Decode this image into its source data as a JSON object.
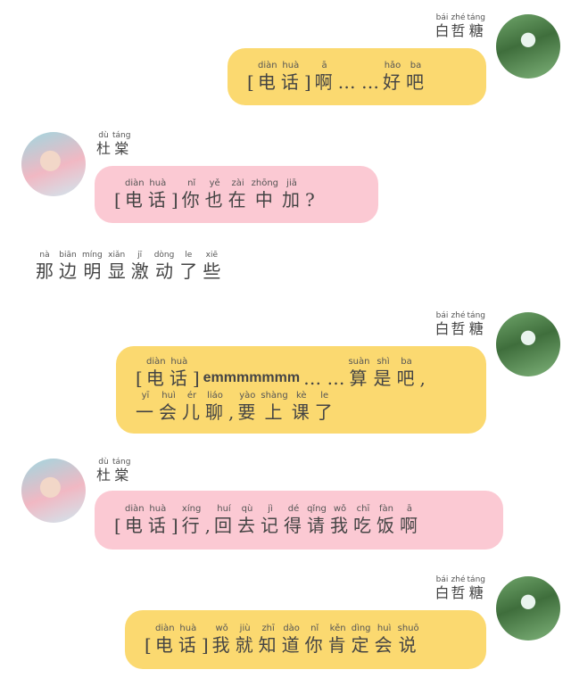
{
  "users": {
    "me": {
      "name": [
        [
          "bái",
          "白"
        ],
        [
          "zhé",
          "哲"
        ],
        [
          "táng",
          "糖"
        ]
      ]
    },
    "other": {
      "name": [
        [
          "dù",
          "杜"
        ],
        [
          "táng",
          "棠"
        ]
      ]
    }
  },
  "messages": [
    {
      "lines": [
        [
          "[",
          ""
        ],
        [
          "电",
          "diàn"
        ],
        [
          "话",
          "huà"
        ],
        [
          "]",
          ""
        ],
        [
          "啊",
          "ā"
        ],
        [
          "… …",
          ""
        ],
        [
          "好",
          "hǎo"
        ],
        [
          "吧",
          "ba"
        ]
      ]
    },
    {
      "lines": [
        [
          "[",
          ""
        ],
        [
          "电",
          "diàn"
        ],
        [
          "话",
          "huà"
        ],
        [
          "]",
          ""
        ],
        [
          "你",
          "nǐ"
        ],
        [
          "也",
          "yě"
        ],
        [
          "在",
          "zài"
        ],
        [
          "中",
          "zhōng"
        ],
        [
          "加",
          "jiā"
        ],
        [
          "?",
          ""
        ]
      ]
    },
    {
      "free": [
        [
          "那",
          "nà"
        ],
        [
          "边",
          "biān"
        ],
        [
          "明",
          "míng"
        ],
        [
          "显",
          "xiǎn"
        ],
        [
          "激",
          "jī"
        ],
        [
          "动",
          "dòng"
        ],
        [
          "了",
          "le"
        ],
        [
          "些",
          "xiē"
        ]
      ]
    },
    {
      "line1": [
        [
          "[",
          ""
        ],
        [
          "电",
          "diàn"
        ],
        [
          "话",
          "huà"
        ],
        [
          "]",
          ""
        ],
        [
          "emmmmmmm",
          ""
        ],
        [
          "… …",
          ""
        ],
        [
          "算",
          "suàn"
        ],
        [
          "是",
          "shì"
        ],
        [
          "吧",
          "ba"
        ],
        [
          ",",
          ""
        ]
      ],
      "line2": [
        [
          "一",
          "yī"
        ],
        [
          "会",
          "huì"
        ],
        [
          "儿",
          "ér"
        ],
        [
          "聊",
          "liáo"
        ],
        [
          ",",
          ""
        ],
        [
          "要",
          "yào"
        ],
        [
          "上",
          "shàng"
        ],
        [
          "课",
          "kè"
        ],
        [
          "了",
          "le"
        ]
      ]
    },
    {
      "lines": [
        [
          "[",
          ""
        ],
        [
          "电",
          "diàn"
        ],
        [
          "话",
          "huà"
        ],
        [
          "]",
          ""
        ],
        [
          "行",
          "xíng"
        ],
        [
          ",",
          ""
        ],
        [
          "回",
          "huí"
        ],
        [
          "去",
          "qù"
        ],
        [
          "记",
          "jì"
        ],
        [
          "得",
          "dé"
        ],
        [
          "请",
          "qǐng"
        ],
        [
          "我",
          "wǒ"
        ],
        [
          "吃",
          "chī"
        ],
        [
          "饭",
          "fàn"
        ],
        [
          "啊",
          "ā"
        ]
      ]
    },
    {
      "lines": [
        [
          "[",
          ""
        ],
        [
          "电",
          "diàn"
        ],
        [
          "话",
          "huà"
        ],
        [
          "]",
          ""
        ],
        [
          "我",
          "wǒ"
        ],
        [
          "就",
          "jiù"
        ],
        [
          "知",
          "zhī"
        ],
        [
          "道",
          "dào"
        ],
        [
          "你",
          "nǐ"
        ],
        [
          "肯",
          "kěn"
        ],
        [
          "定",
          "dìng"
        ],
        [
          "会",
          "huì"
        ],
        [
          "说",
          "shuō"
        ]
      ]
    }
  ]
}
